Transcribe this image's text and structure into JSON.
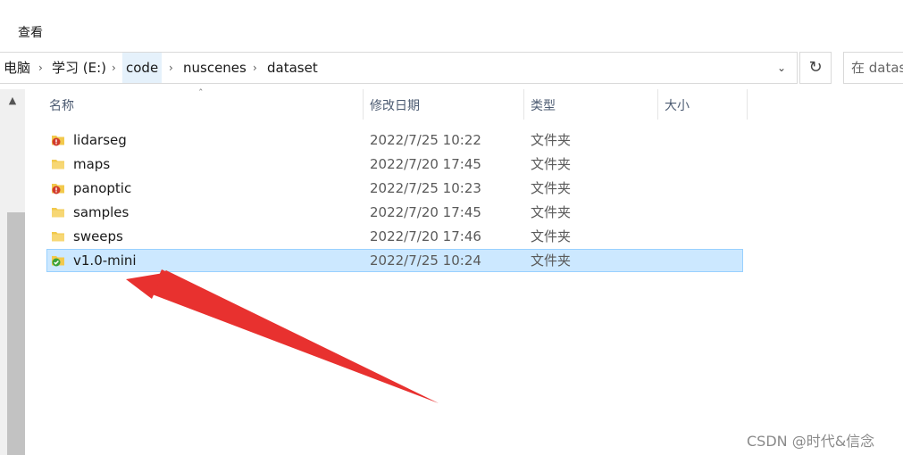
{
  "ribbon": {
    "view_tab": "查看"
  },
  "address": {
    "crumbs": [
      "电脑",
      "学习 (E:)",
      "code",
      "nuscenes",
      "dataset"
    ],
    "search_placeholder": "在 datas"
  },
  "columns": {
    "name": "名称",
    "modified": "修改日期",
    "type": "类型",
    "size": "大小"
  },
  "files": [
    {
      "name": "lidarseg",
      "modified": "2022/7/25 10:22",
      "type": "文件夹",
      "icon": "folder-error-icon",
      "selected": false
    },
    {
      "name": "maps",
      "modified": "2022/7/20 17:45",
      "type": "文件夹",
      "icon": "folder-icon",
      "selected": false
    },
    {
      "name": "panoptic",
      "modified": "2022/7/25 10:23",
      "type": "文件夹",
      "icon": "folder-error-icon",
      "selected": false
    },
    {
      "name": "samples",
      "modified": "2022/7/20 17:45",
      "type": "文件夹",
      "icon": "folder-icon",
      "selected": false
    },
    {
      "name": "sweeps",
      "modified": "2022/7/20 17:46",
      "type": "文件夹",
      "icon": "folder-icon",
      "selected": false
    },
    {
      "name": "v1.0-mini",
      "modified": "2022/7/25 10:24",
      "type": "文件夹",
      "icon": "folder-ok-icon",
      "selected": true
    }
  ],
  "colors": {
    "selection": "#cce8ff",
    "selection_border": "#99d1ff",
    "arrow": "#e8312f"
  },
  "watermark": "CSDN @时代&信念"
}
